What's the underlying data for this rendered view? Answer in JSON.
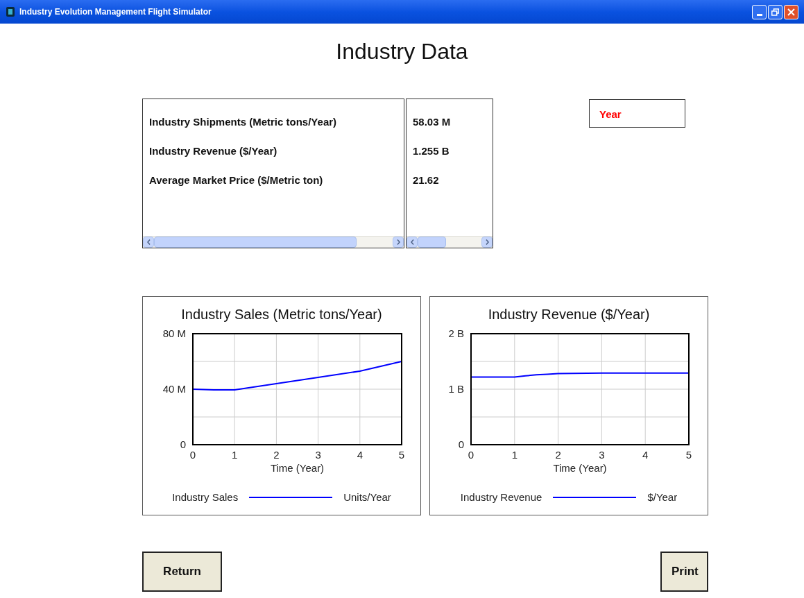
{
  "window": {
    "title": "Industry Evolution Management Flight Simulator"
  },
  "page_title": "Industry Data",
  "table": {
    "rows": [
      {
        "label": "Industry Shipments (Metric tons/Year)",
        "value": "58.03 M"
      },
      {
        "label": "Industry Revenue ($/Year)",
        "value": "1.255 B"
      },
      {
        "label": "Average Market Price ($/Metric ton)",
        "value": "21.62"
      }
    ]
  },
  "year_field": {
    "label": "Year"
  },
  "charts": [
    {
      "chart_data": {
        "type": "line",
        "title": "Industry Sales (Metric tons/Year)",
        "xlabel": "Time (Year)",
        "x": [
          0,
          0.5,
          1,
          2,
          3,
          4,
          5
        ],
        "series": [
          {
            "name": "Industry Sales",
            "color": "#0000ff",
            "values": [
              40000000,
              39500000,
              39500000,
              44000000,
              48500000,
              53000000,
              60000000
            ]
          }
        ],
        "xlim": [
          0,
          5
        ],
        "ylim": [
          0,
          80000000
        ],
        "grid": true,
        "xticks": [
          0,
          1,
          2,
          3,
          4,
          5
        ],
        "yticks": [
          {
            "value": 0,
            "label": "0"
          },
          {
            "value": 40000000,
            "label": "40 M"
          },
          {
            "value": 80000000,
            "label": "80 M"
          }
        ]
      },
      "legend_unit": "Units/Year"
    },
    {
      "chart_data": {
        "type": "line",
        "title": "Industry Revenue ($/Year)",
        "xlabel": "Time (Year)",
        "x": [
          0,
          1,
          1.25,
          1.5,
          1.75,
          2,
          3,
          4,
          5
        ],
        "series": [
          {
            "name": "Industry Revenue",
            "color": "#0000ff",
            "values": [
              1220000000,
              1220000000,
              1240000000,
              1260000000,
              1270000000,
              1280000000,
              1290000000,
              1290000000,
              1290000000
            ]
          }
        ],
        "xlim": [
          0,
          5
        ],
        "ylim": [
          0,
          2000000000
        ],
        "grid": true,
        "xticks": [
          0,
          1,
          2,
          3,
          4,
          5
        ],
        "yticks": [
          {
            "value": 0,
            "label": "0"
          },
          {
            "value": 1000000000,
            "label": "1 B"
          },
          {
            "value": 2000000000,
            "label": "2 B"
          }
        ]
      },
      "legend_unit": "$/Year"
    }
  ],
  "buttons": [
    {
      "label": "Return"
    },
    {
      "label": "Print"
    }
  ]
}
